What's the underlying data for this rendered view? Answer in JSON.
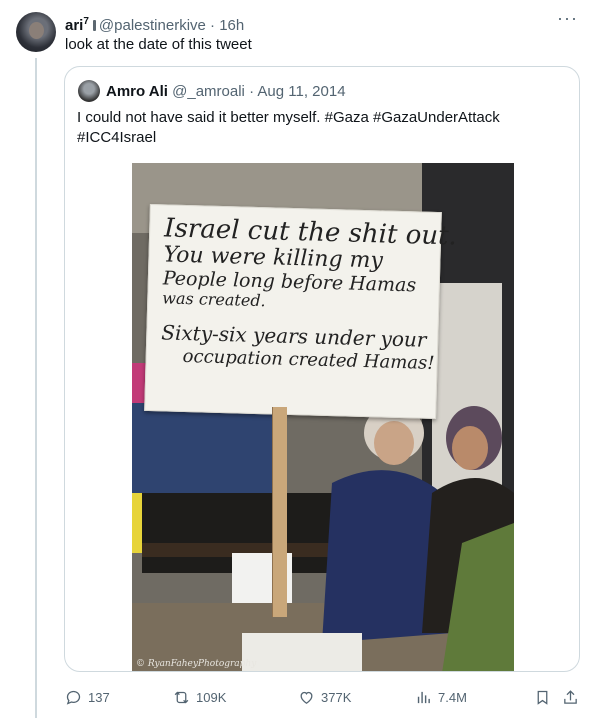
{
  "tweet": {
    "author_name": "ari",
    "author_sup": "7",
    "handle": "@palestinerkive",
    "separator": "·",
    "time": "16h",
    "text": "look at the date of this tweet",
    "more": "···"
  },
  "quote": {
    "author_name": "Amro Ali",
    "handle": "@_amroali",
    "separator": "·",
    "date": "Aug 11, 2014",
    "text_line1": "I could not have said it better myself. #Gaza #GazaUnderAttack",
    "text_line2": "#ICC4Israel",
    "image": {
      "sign_lines": [
        "Israel cut the shit out.",
        "You were killing my",
        "People long before Hamas",
        "was created.",
        "Sixty-six years under your",
        "occupation created Hamas!"
      ],
      "credit": "© RyanFaheyPhotography"
    }
  },
  "actions": {
    "replies": "137",
    "reposts": "109K",
    "likes": "377K",
    "views": "7.4M"
  },
  "colors": {
    "secondary_text": "#536471",
    "border": "#cfd9de",
    "primary_text": "#0f1419"
  }
}
